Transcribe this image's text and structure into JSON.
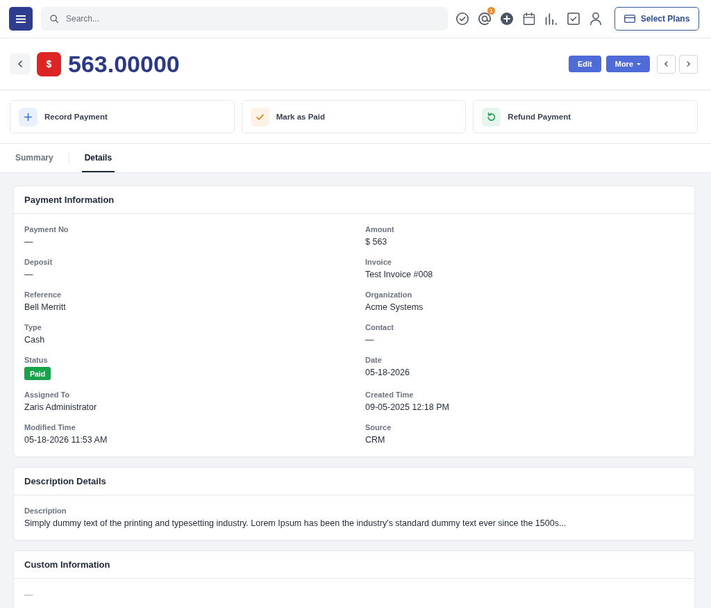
{
  "top_bar": {
    "search": {
      "placeholder": "Search..."
    },
    "mentions_badge": "1",
    "plans_button": "Select Plans"
  },
  "header": {
    "record_icon": "$",
    "title": "563.00000",
    "buttons": [
      {
        "kind": "primary",
        "label": "Edit"
      },
      {
        "kind": "dropdown",
        "label": "More"
      }
    ]
  },
  "quick_actions": [
    {
      "kind": "add",
      "label": "Record Payment"
    },
    {
      "kind": "check",
      "label": "Mark as Paid"
    },
    {
      "kind": "refund",
      "label": "Refund Payment"
    }
  ],
  "tabs": [
    {
      "label": "Summary",
      "selected": false
    },
    {
      "label": "Details",
      "selected": true
    }
  ],
  "sections": [
    {
      "title": "Payment Information",
      "fields": [
        {
          "kind": "text",
          "label": "Payment No",
          "value": "—"
        },
        {
          "kind": "text",
          "label": "Amount",
          "value": "$ 563"
        },
        {
          "kind": "text",
          "label": "Deposit",
          "value": "—"
        },
        {
          "kind": "text",
          "label": "Invoice",
          "value": "Test Invoice #008"
        },
        {
          "kind": "text",
          "label": "Reference",
          "value": "Bell Merritt"
        },
        {
          "kind": "text",
          "label": "Organization",
          "value": "Acme Systems"
        },
        {
          "kind": "text",
          "label": "Type",
          "value": "Cash"
        },
        {
          "kind": "text",
          "label": "Contact",
          "value": "—"
        },
        {
          "kind": "badge",
          "label": "Status",
          "value": "Paid"
        },
        {
          "kind": "text",
          "label": "Date",
          "value": "05-18-2026"
        },
        {
          "kind": "text",
          "label": "Assigned To",
          "value": "Zaris Administrator"
        },
        {
          "kind": "text",
          "label": "Created Time",
          "value": "09-05-2025 12:18 PM"
        },
        {
          "kind": "text",
          "label": "Modified Time",
          "value": "05-18-2026 11:53 AM"
        },
        {
          "kind": "text",
          "label": "Source",
          "value": "CRM"
        }
      ]
    },
    {
      "title": "Description Details",
      "fields": [
        {
          "kind": "wide",
          "label": "Description",
          "value": "Simply dummy text of the printing and typesetting industry. Lorem Ipsum has been the industry's standard dummy text ever since the 1500s..."
        }
      ]
    },
    {
      "title": "Custom Information",
      "fields": [
        {
          "kind": "bare",
          "value": "—"
        }
      ]
    }
  ]
}
